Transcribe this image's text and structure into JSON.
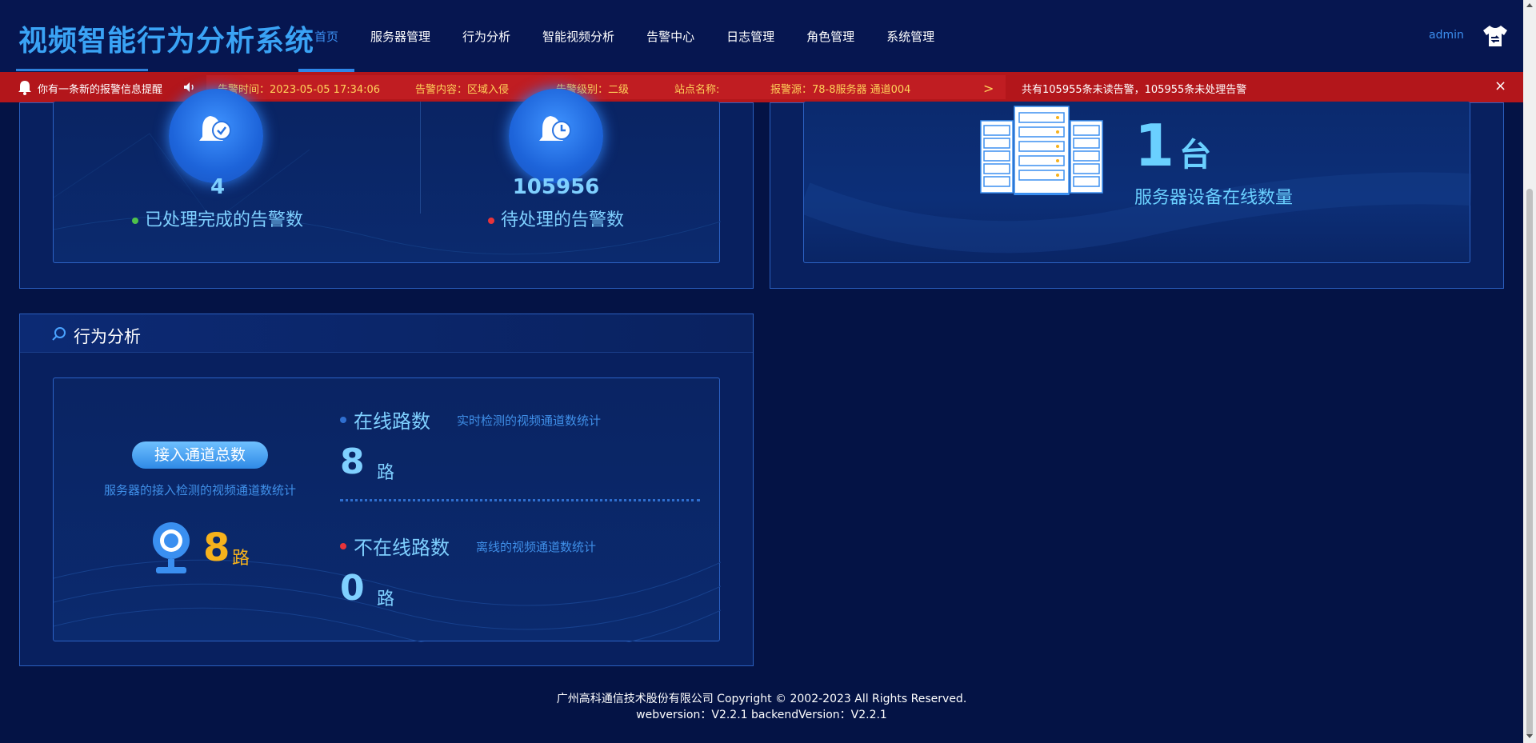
{
  "header": {
    "logo": "视频智能行为分析系统",
    "nav": [
      {
        "label": "首页",
        "active": true
      },
      {
        "label": "服务器管理"
      },
      {
        "label": "行为分析"
      },
      {
        "label": "智能视频分析"
      },
      {
        "label": "告警中心"
      },
      {
        "label": "日志管理"
      },
      {
        "label": "角色管理"
      },
      {
        "label": "系统管理"
      }
    ],
    "user": "admin",
    "skin_icon": "shirt-swap-icon"
  },
  "alert_bar": {
    "title": "你有一条新的报警信息提醒",
    "time": "告警时间：2023-05-05 17:34:06",
    "content": "告警内容：区域入侵",
    "level": "告警级别：二级",
    "station": "站点名称:",
    "source": "报警源：78-8服务器 通道004",
    "next": ">",
    "summary": "共有105955条未读告警，105955条未处理告警",
    "close": "×",
    "colors": {
      "bar": "#b3161b",
      "detail_text": "#ffd25a"
    }
  },
  "alarm_stats": {
    "handled": {
      "value": "4",
      "label": "已处理完成的告警数",
      "dot_color": "#4fc24a"
    },
    "pending": {
      "value": "105956",
      "label": "待处理的告警数",
      "dot_color": "#e8343a"
    }
  },
  "server_stats": {
    "count": "1",
    "unit": "台",
    "label": "服务器设备在线数量"
  },
  "behavior": {
    "title": "行为分析",
    "total_button": "接入通道总数",
    "total_desc": "服务器的接入检测的视频通道数统计",
    "total_value": "8",
    "total_unit": "路",
    "online": {
      "title": "在线路数",
      "desc": "实时检测的视频通道数统计",
      "value": "8",
      "unit": "路",
      "dot_color": "#2f6fd0"
    },
    "offline": {
      "title": "不在线路数",
      "desc": "离线的视频通道数统计",
      "value": "0",
      "unit": "路",
      "dot_color": "#e8343a"
    }
  },
  "footer": {
    "copyright": "广州高科通信技术股份有限公司 Copyright © 2002-2023 All Rights Reserved.",
    "version": "webversion：V2.2.1 backendVersion：V2.2.1"
  }
}
